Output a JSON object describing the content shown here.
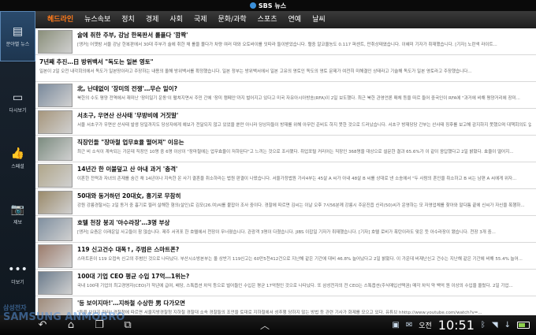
{
  "app": {
    "title": "SBS 뉴스"
  },
  "sidebar": {
    "items": [
      {
        "label": "분야별 뉴스",
        "icon": "news-list-icon",
        "glyph": "▤"
      },
      {
        "label": "다시보기",
        "icon": "tv-icon",
        "glyph": "▭"
      },
      {
        "label": "스페셜",
        "icon": "thumbs-up-icon",
        "glyph": "👍"
      },
      {
        "label": "제보",
        "icon": "camera-icon",
        "glyph": "📷"
      },
      {
        "label": "더보기",
        "icon": "more-icon",
        "glyph": "•••"
      }
    ]
  },
  "tabs": [
    "헤드라인",
    "뉴스속보",
    "정치",
    "경제",
    "사회",
    "국제",
    "문화/과학",
    "스포츠",
    "연예",
    "날씨"
  ],
  "articles": [
    {
      "title": "술에 취한 주부, 강남 한복판서 롤플다 '깜짝'",
      "snippet": "[앵커] 어젯밤 서울 강남 한복판에서 30대 주부가 술에 취한 채 롤을 몰다가 차량 여러 대와 오토바이를 잇따라 들이받았습니다. 혈중 알코올농도 0.117 퍼센트, 만취상태였습니다. 이혜미 기자가 취재했습니다. [기자] 노란색 라이트...",
      "thumb": true
    },
    {
      "title": "7년째 추진…日 방위백서 \"독도는 일본 영토\"",
      "snippet": "일본이 2일 오전 내각회의에서 독도가 일본땅이라고 주장하는 내용의 올해 방위백서를 확정했습니다. 일본 정부는 방위백서에서 일본 고유의 영토인 독도의 영토 문제가 여전히 미해결인 상태라고 기술해 독도가 일본 영토라고 주장했습니다...",
      "thumb": false
    },
    {
      "title": "北, 난데없이 '장미의 전쟁'…무슨 일이?",
      "snippet": "북한의 수도 평양 전역에서 재미난 '장미일기 운동'이 펼쳐지면서 주민 간에 '장미 캠페인'까지 벌어지고 있다고 미국 자유아시아방송(RFA)이 2일 보도했다. 최근 북한 관영언론 매체 등을 따르 들어 중국인이 RFA에 \"과거에 비해 평양거리에 장미...",
      "thumb": true
    },
    {
      "title": "서초구, 우면산 산사태 '무방비에 거짓말'",
      "snippet": "서울 서초구가 우면산 산사태 발생 당일까지도 당상자에게 예보가 전달되지 않고 있었을 뿐만 아니라 당상자들이 방재를 위해 아무런 준비도 하지 못한 것으로 드러났습니다. 서초구 방재당당 간부는 산사태 징후를 보고해 감지하지 못했으며 대책회의도 없었...",
      "thumb": true
    },
    {
      "title": "직장인들 \"장마철 업무효율 떨어져\" 이유는",
      "snippet": "최근 비 소식이 계속되는 가운데 직장인 10명 중 6명 이상이 \"장마철에는 업무효율이 저하된다\"고 느끼는 것으로 조사됐다. 취업포털 커리어는 직장인 368명을 대상으로 설문한 결과 65.6%가 이 같이 응답했다고 2일 밝혔다. 효율이 떨어지...",
      "thumb": true
    },
    {
      "title": "14년간 한 이불덮고 산 아내 과거 '충격'",
      "snippet": "이혼한 전력과 자녀의 존재를 숨긴 채 14년이나 지속한 온 사기 결혼을 취소하라는 법원 판결이 나왔습니다. 서울가정법원 가사4부는 45살 A 씨가 아내 48살 B 씨를 상대로 낸 소송에서 \"두 사람의 혼인을 취소하고 B 씨는 남편 A 씨에게 위자...",
      "thumb": true
    },
    {
      "title": "50대와 동거하던 20대女, 흉기로 무참히",
      "snippet": "강원 강릉경찰서는 2일 동거 중 흉기로 찔러 살해한 혐의(살인)로 김모(26.여)씨를 붙잡아 조사 중이다. 경찰에 따르면 김씨는 이날 오후 7시56분께 강릉시 주문진읍 신리(50)씨가 운영하는 모 자영업체를 찾아와 말다툼 끝에 신씨가 자신을 폭행하...",
      "thumb": true
    },
    {
      "title": "호텔 천장 붕괴 '아수라장'…3명 부상",
      "snippet": "[앵커] 요즘은 이래운일 사고들이 참 많습니다. 제주 서귀포 한 호텔에서 천장이 무너졌습니다. 관광객 3명이 다쳤습니다. JIBS 이잡일 기자가 취재했습니다. [기자] 호텔 로비가 폭탄이라도 맞은 듯 아수라장이 됐습니다. 천장 3개 중...",
      "thumb": true
    },
    {
      "title": "119 신고건수 대폭↑, 주범은 스마트폰?",
      "snippet": "스마트폰이 119 오접속 신고의 주범인 것으로 나타났다. 부산시소방본부는 올 상반기 119신고는 60만5천412건으로 지난해 같은 기간에 대비 46.8% 늘어났다고 2일 밝혔다. 이 가운데 비재난신고 건수는 지난해 같은 기간에 비해 55.4% 늘어...",
      "thumb": true
    },
    {
      "title": "100대 기업 CEO 평균 수입 17억…1위는?",
      "snippet": "국내 100대 기업의 최고경영자(CEO)가 작년에 급여, 배당, 스톡옵션 차익 등으로 벌어들인 수입은 평균 17억원인 것으로 나타났다. 또 삼성전자의 전 CEO는 스톡옵션(주식매입선택권) 매각 차익 약 백억 원 이상의 수입을 올렸다. 2일 기업...",
      "thumb": true
    },
    {
      "title": "'등 보이지마!'…지하철 수상한 男 다가오면",
      "snippet": "\"등을 보이지 마라\" 경찰청에 따르면 서울지방경찰청 지하철 경찰대 소속 경찰들의 조언을 토대로 지하철에서 성추행 당하지 않는 방법 등 관련 기사가 화제를 모으고 있다. 유튜브 hhttp://www.youtube.com/watch?v=...",
      "thumb": true
    }
  ],
  "status": {
    "ampm": "오전",
    "time": "10:51",
    "battery_level": 0.65
  },
  "watermark": {
    "line1": "삼성전자",
    "line2": "SAMSUNG ANMOBRO"
  }
}
